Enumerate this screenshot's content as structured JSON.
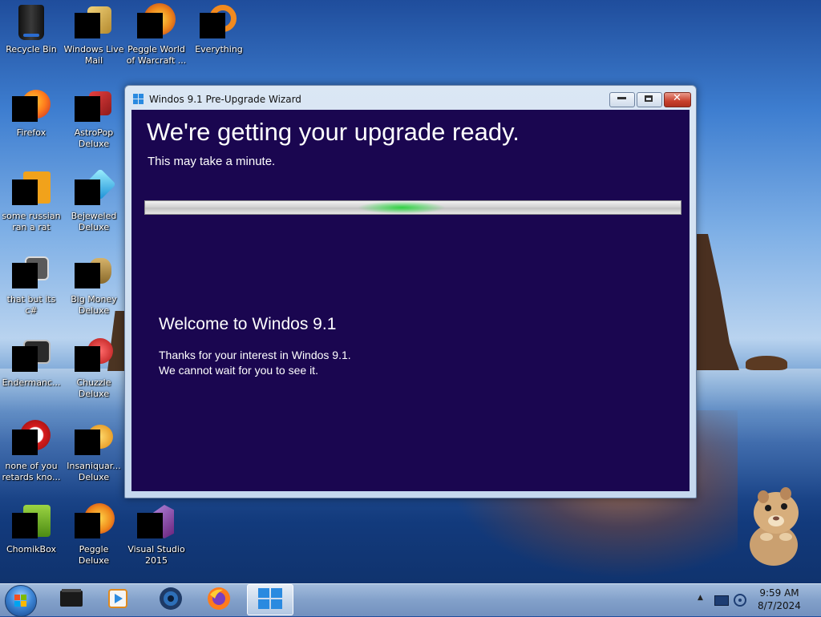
{
  "desktop": {
    "icons": [
      {
        "label": "Recycle Bin"
      },
      {
        "label": "Windows Live\nMail"
      },
      {
        "label": "Peggle World\nof Warcraft ..."
      },
      {
        "label": "Everything"
      },
      {
        "label": "Firefox"
      },
      {
        "label": "AstroPop\nDeluxe"
      },
      {
        "label": "some russian\nran a rat"
      },
      {
        "label": "Bejeweled\nDeluxe"
      },
      {
        "label": "that but its c#"
      },
      {
        "label": "Big Money\nDeluxe"
      },
      {
        "label": "Endermanc..."
      },
      {
        "label": "Chuzzle\nDeluxe"
      },
      {
        "label": "none of you\nretards kno..."
      },
      {
        "label": "Insaniquar...\nDeluxe"
      },
      {
        "label": "ChomikBox"
      },
      {
        "label": "Peggle Deluxe"
      },
      {
        "label": "Visual Studio\n2015"
      }
    ]
  },
  "window": {
    "title": "Windos 9.1 Pre-Upgrade Wizard",
    "close_glyph": "✕"
  },
  "wizard": {
    "heading": "We're getting your upgrade ready.",
    "subheading": "This may take a minute.",
    "progress_state": "indeterminate",
    "welcome_title": "Welcome to Windos 9.1",
    "welcome_line1": "Thanks for your interest in Windos 9.1.",
    "welcome_line2": "We cannot wait for you to see it."
  },
  "taskbar": {
    "apps": [
      "start-button",
      "terminal-app-icon",
      "media-player-icon",
      "globe-app-icon",
      "firefox-icon",
      "windows-app-icon"
    ],
    "tray_arrow": "▲",
    "clock_time": "9:59 AM",
    "clock_date": "8/7/2024"
  }
}
